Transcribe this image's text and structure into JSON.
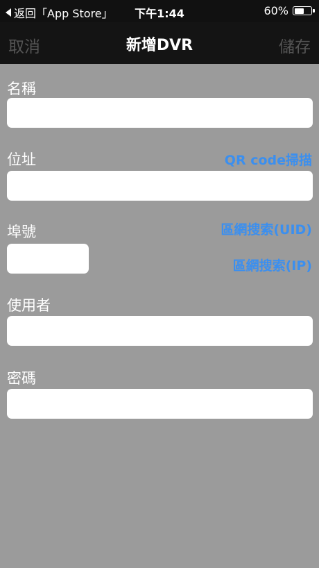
{
  "status_bar": {
    "back_label": "返回「App Store」",
    "time": "下午1:44",
    "battery_text": "60%",
    "battery_level": 0.6
  },
  "nav": {
    "cancel": "取消",
    "title": "新增DVR",
    "save": "儲存"
  },
  "form": {
    "name": {
      "label": "名稱",
      "value": ""
    },
    "address": {
      "label": "位址",
      "value": "",
      "qr_link": "QR code掃描"
    },
    "port": {
      "label": "埠號",
      "value": "",
      "lan_uid_link": "區網搜索(UID)",
      "lan_ip_link": "區網搜索(IP)"
    },
    "user": {
      "label": "使用者",
      "value": ""
    },
    "password": {
      "label": "密碼",
      "value": ""
    }
  },
  "colors": {
    "background": "#9b9b9b",
    "bar": "#141414",
    "link": "#3b8fef",
    "disabled_nav": "#555555"
  }
}
